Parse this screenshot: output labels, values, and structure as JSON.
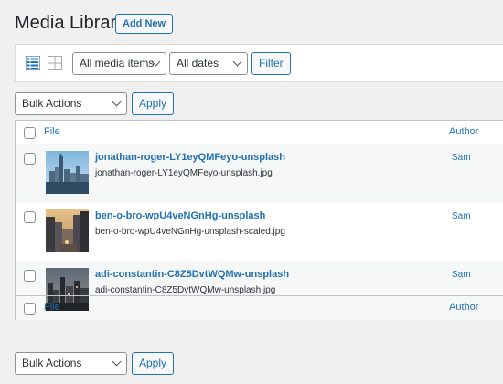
{
  "header": {
    "title": "Media Library",
    "add_new": "Add New"
  },
  "toolbar": {
    "view_list_icon": "list-view-icon",
    "view_grid_icon": "grid-view-icon",
    "media_type": "All media items",
    "date": "All dates",
    "filter": "Filter"
  },
  "bulk_top": {
    "action": "Bulk Actions",
    "apply": "Apply"
  },
  "bulk_bottom": {
    "action": "Bulk Actions",
    "apply": "Apply"
  },
  "table": {
    "columns": {
      "file": "File",
      "author": "Author"
    },
    "rows": [
      {
        "title": "jonathan-roger-LY1eyQMFeyo-unsplash",
        "filename": "jonathan-roger-LY1eyQMFeyo-unsplash.jpg",
        "author": "Sam"
      },
      {
        "title": "ben-o-bro-wpU4veNGnHg-unsplash",
        "filename": "ben-o-bro-wpU4veNGnHg-unsplash-scaled.jpg",
        "author": "Sam"
      },
      {
        "title": "adi-constantin-C8Z5DvtWQMw-unsplash",
        "filename": "adi-constantin-C8Z5DvtWQMw-unsplash.jpg",
        "author": "Sam"
      }
    ]
  },
  "colors": {
    "accent": "#2271b1",
    "text": "#1d2327",
    "background": "#f0f0f1"
  }
}
